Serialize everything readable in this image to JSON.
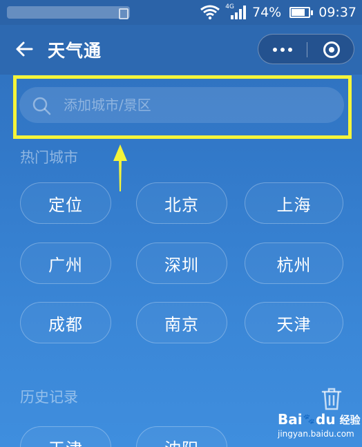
{
  "status_bar": {
    "network": "4G",
    "battery": "74%",
    "battery_level": 0.74,
    "time": "09:37"
  },
  "header": {
    "title": "天气通",
    "icons": {
      "back": "arrow-left",
      "more": "three-dots",
      "close": "target-circle"
    }
  },
  "search": {
    "placeholder": "添加城市/景区",
    "value": "",
    "highlight_color": "#f4f43a"
  },
  "hot_cities": {
    "label": "热门城市",
    "items": [
      "定位",
      "北京",
      "上海",
      "广州",
      "深圳",
      "杭州",
      "成都",
      "南京",
      "天津"
    ]
  },
  "history": {
    "label": "历史记录",
    "items": [
      "天津",
      "沈阳"
    ],
    "trash_icon": "trash-can"
  },
  "watermark": {
    "brand": "Baidu经验",
    "brand_left": "Bai",
    "brand_mid": "du",
    "brand_right": "经验",
    "url": "jingyan.baidu.com"
  }
}
